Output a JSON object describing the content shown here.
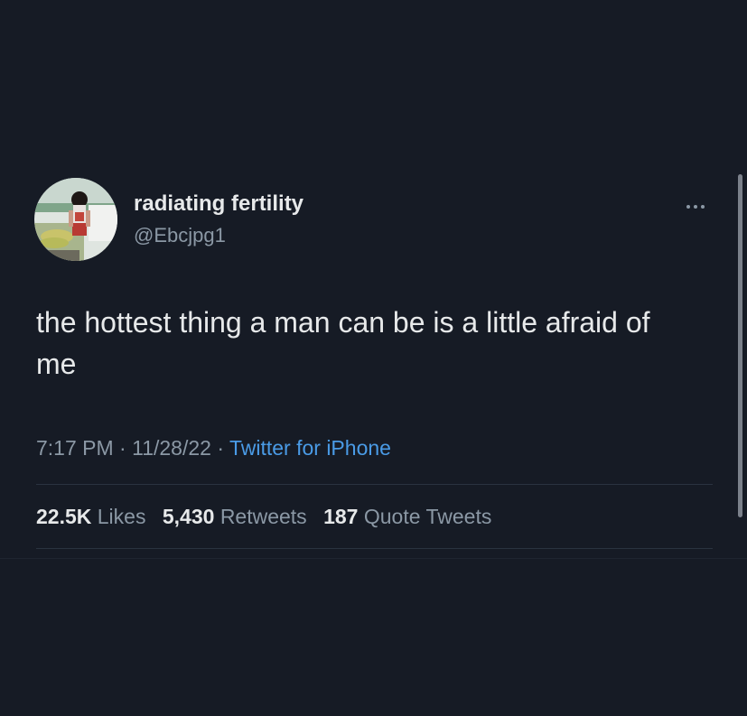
{
  "user": {
    "display_name": "radiating fertility",
    "handle": "@Ebcjpg1"
  },
  "tweet": {
    "text": "the hottest thing a man can be is a little afraid of me",
    "time": "7:17 PM",
    "date": "11/28/22",
    "source": "Twitter for iPhone"
  },
  "stats": {
    "likes_count": "22.5K",
    "likes_label": "Likes",
    "retweets_count": "5,430",
    "retweets_label": "Retweets",
    "quotes_count": "187",
    "quotes_label": "Quote Tweets"
  },
  "icons": {
    "more": "more-options-icon"
  },
  "colors": {
    "background": "#161b25",
    "primary_text": "#e7e9ea",
    "secondary_text": "#8b98a5",
    "link": "#4a9be6"
  }
}
